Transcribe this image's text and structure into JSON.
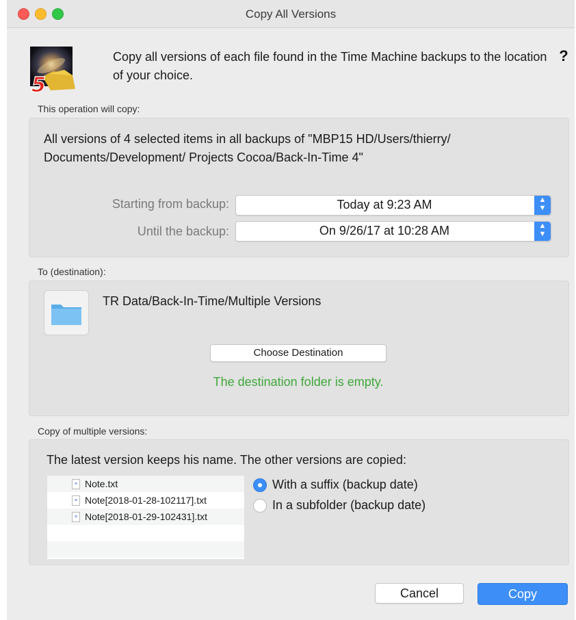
{
  "window": {
    "title": "Copy All Versions"
  },
  "intro": {
    "text": "Copy all versions of each file found in the Time Machine backups to the location of your choice.",
    "help": "?"
  },
  "copy_section": {
    "label": "This operation will copy:",
    "description": "All versions of 4 selected items in all backups of \"MBP15 HD/Users/thierry/ Documents/Development/ Projects Cocoa/Back-In-Time 4\"",
    "start_label": "Starting from backup:",
    "start_value": "Today at 9:23 AM",
    "until_label": "Until the backup:",
    "until_value": "On 9/26/17 at 10:28 AM"
  },
  "destination": {
    "label": "To (destination):",
    "path": "TR Data/Back-In-Time/Multiple Versions",
    "choose_button": "Choose Destination",
    "status": "The destination folder is empty.",
    "status_color": "#3fa83a"
  },
  "multiple_versions": {
    "label": "Copy of multiple versions:",
    "description": "The latest version keeps his name. The other versions are copied:",
    "files": [
      "Note.txt",
      "Note[2018-01-28-102117].txt",
      "Note[2018-01-29-102431].txt"
    ],
    "options": [
      {
        "label": "With a suffix (backup date)",
        "selected": true
      },
      {
        "label": "In a subfolder (backup date)",
        "selected": false
      }
    ]
  },
  "buttons": {
    "cancel": "Cancel",
    "copy": "Copy"
  },
  "colors": {
    "accent": "#3d8ef7"
  },
  "icons": {
    "app": "back-in-time-5-icon",
    "folder": "folder-icon",
    "file": "text-file-icon",
    "popup": "up-down-chevron-icon"
  }
}
